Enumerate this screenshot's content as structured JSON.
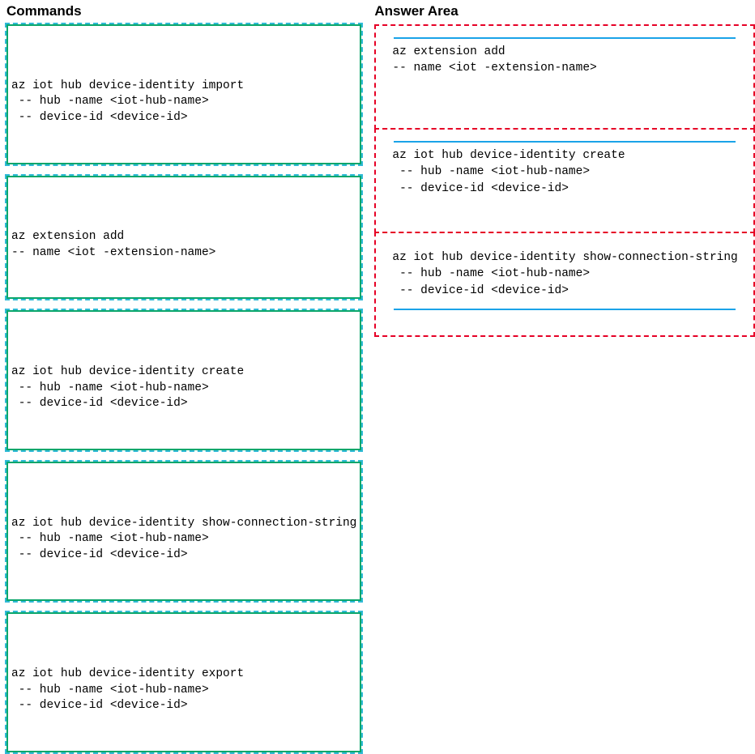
{
  "left": {
    "heading": "Commands",
    "boxes": [
      "az iot hub device-identity import\n -- hub -name <iot-hub-name>\n -- device-id <device-id>",
      "az extension add\n-- name <iot -extension-name>",
      "az iot hub device-identity create\n -- hub -name <iot-hub-name>\n -- device-id <device-id>",
      "az iot hub device-identity show-connection-string\n -- hub -name <iot-hub-name>\n -- device-id <device-id>",
      "az iot hub device-identity export\n -- hub -name <iot-hub-name>\n -- device-id <device-id>"
    ]
  },
  "right": {
    "heading": "Answer Area",
    "slots": [
      "az extension add\n-- name <iot -extension-name>",
      "az iot hub device-identity create\n -- hub -name <iot-hub-name>\n -- device-id <device-id>",
      "az iot hub device-identity show-connection-string\n -- hub -name <iot-hub-name>\n -- device-id <device-id>"
    ]
  }
}
